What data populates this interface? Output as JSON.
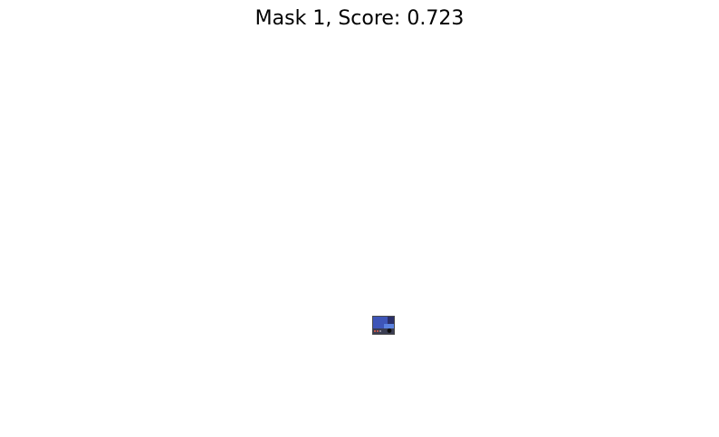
{
  "figure": {
    "title": "Mask 1, Score: 0.723",
    "background_color": "#ffffff",
    "mask_region_colors": {
      "frame": "#4a4a4a",
      "screen_blue": "#3e55b8",
      "light_blue": "#5b82e0",
      "panel_dark": "#2a2f6a",
      "dot": "#0b0b0b",
      "accent_red": "#c0564a"
    }
  }
}
